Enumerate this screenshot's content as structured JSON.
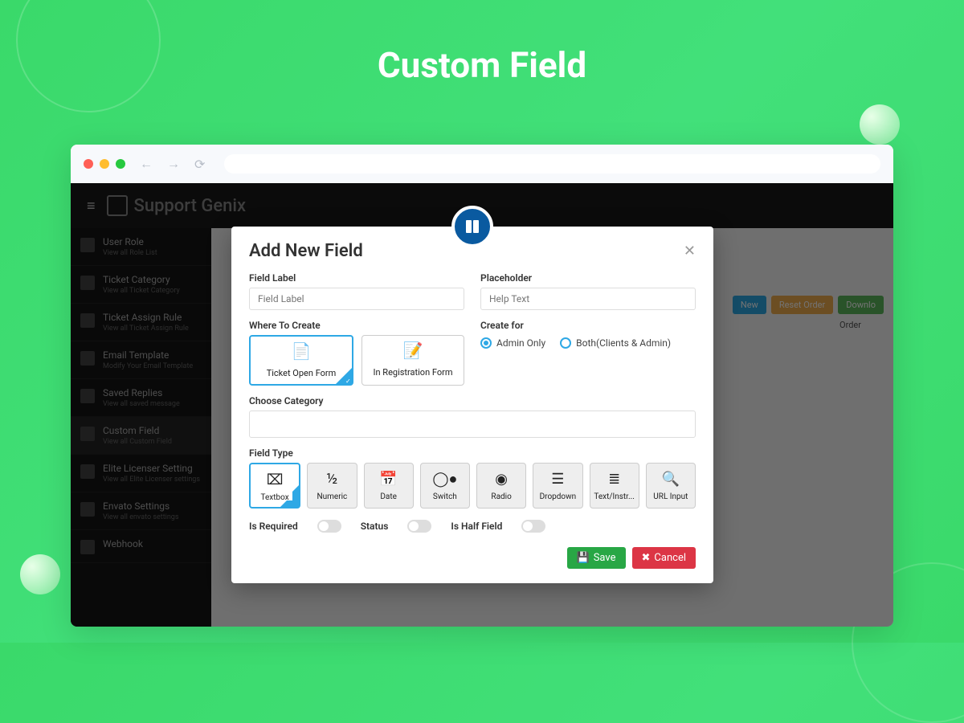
{
  "page": {
    "title": "Custom Field"
  },
  "app": {
    "brand": "Support Genix"
  },
  "sidebar": {
    "items": [
      {
        "title": "User Role",
        "sub": "View all Role List"
      },
      {
        "title": "Ticket Category",
        "sub": "View all Ticket Category"
      },
      {
        "title": "Ticket Assign Rule",
        "sub": "View all Ticket Assign Rule"
      },
      {
        "title": "Email Template",
        "sub": "Modify Your Email Template"
      },
      {
        "title": "Saved Replies",
        "sub": "View all saved message"
      },
      {
        "title": "Custom Field",
        "sub": "View all Custom Field"
      },
      {
        "title": "Elite Licenser Setting",
        "sub": "View all Elite Licenser settings"
      },
      {
        "title": "Envato Settings",
        "sub": "View all envato settings"
      },
      {
        "title": "Webhook",
        "sub": ""
      }
    ]
  },
  "toolbar": {
    "btn_new": "New",
    "btn_reset": "Reset Order",
    "btn_download": "Downlo"
  },
  "table": {
    "col_order": "Order"
  },
  "modal": {
    "title": "Add New Field",
    "field_label_label": "Field Label",
    "field_label_placeholder": "Field Label",
    "placeholder_label": "Placeholder",
    "placeholder_placeholder": "Help Text",
    "where_create_label": "Where To Create",
    "where_options": [
      {
        "label": "Ticket Open Form"
      },
      {
        "label": "In Registration Form"
      }
    ],
    "create_for_label": "Create for",
    "create_for_options": [
      {
        "label": "Admin Only"
      },
      {
        "label": "Both(Clients & Admin)"
      }
    ],
    "choose_category_label": "Choose Category",
    "field_type_label": "Field Type",
    "field_types": [
      {
        "label": "Textbox"
      },
      {
        "label": "Numeric"
      },
      {
        "label": "Date"
      },
      {
        "label": "Switch"
      },
      {
        "label": "Radio"
      },
      {
        "label": "Dropdown"
      },
      {
        "label": "Text/Instr..."
      },
      {
        "label": "URL Input"
      }
    ],
    "is_required_label": "Is Required",
    "status_label": "Status",
    "is_half_label": "Is Half Field",
    "save_label": "Save",
    "cancel_label": "Cancel"
  }
}
